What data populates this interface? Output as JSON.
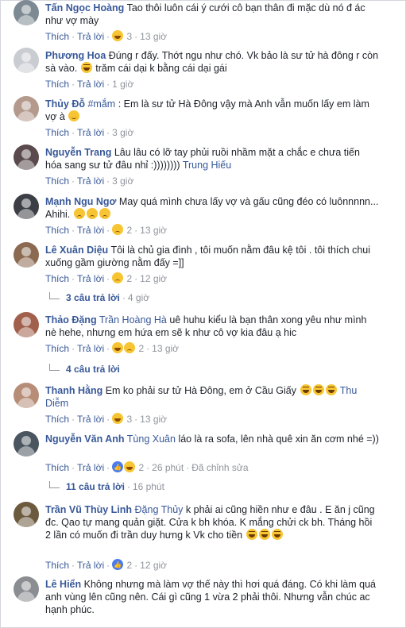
{
  "labels": {
    "like": "Thích",
    "reply": "Trả lời"
  },
  "colors": {
    "link": "#385898",
    "grey": "#90949c",
    "text": "#1d2129"
  },
  "comments": [
    {
      "author": "Tấn Ngọc Hoàng",
      "pre": "",
      "mention": "",
      "text": "Tao thôi luôn cái ý cưới cô bạn thân đi mặc dù nó đ ác như vợ mày",
      "reactions": "3",
      "time": "13 giờ",
      "avatar_color": "#7d8a93"
    },
    {
      "author": "Phương Hoa",
      "pre": "",
      "mention": "",
      "text": "Đúng r đấy. Thớt ngu như chó. Vk bảo là sư tử hà đông r còn sà vào.",
      "text2": "trăm cái dại k bằng cái dại gái",
      "reactions": "",
      "time": "1 giờ",
      "avatar_color": "#c9ccd1"
    },
    {
      "author": "Thủy Đỗ",
      "pre": "",
      "mention": "#mắm",
      "text": " : Em là sư tử Hà Đông vậy mà Anh vẫn muốn lấy em làm vợ à",
      "reactions": "",
      "time": "3 giờ",
      "avatar_color": "#b49a8d"
    },
    {
      "author": "Nguyễn Trang",
      "pre": "",
      "mention": "",
      "text": "Lâu lâu có lỡ tay phủi ruồi nhầm mặt a chắc e chưa tiến hóa sang sư tử đâu nhỉ :))))))))",
      "mention_end": "Trung Hiếu",
      "reactions": "",
      "time": "3 giờ",
      "avatar_color": "#5a4a4d"
    },
    {
      "author": "Mạnh Ngu Ngơ",
      "pre": "",
      "mention": "",
      "text": "May quá mình chưa lấy vợ và gấu cũng đéo có luônnnnn... Ahihi.",
      "reactions": "2",
      "time": "13 giờ",
      "avatar_color": "#3b3f45"
    },
    {
      "author": "Lê Xuân Diệu",
      "pre": "",
      "mention": "",
      "text": "Tôi là chủ gia đình , tôi muốn nằm đâu kệ tôi . tôi thích chui xuống gầm giường nằm đấy =]]",
      "reactions": "2",
      "time": "12 giờ",
      "avatar_color": "#8c6a52"
    },
    {
      "author": "Thảo Đặng",
      "pre": "",
      "mention": "Trần Hoàng Hà",
      "text": " uê huhu kiểu là bạn thân xong yêu như mình nè hehe, nhưng em hứa em sẽ k như cô vợ kia đâu ạ hic",
      "reactions": "2",
      "time": "13 giờ",
      "avatar_color": "#a0604c"
    },
    {
      "author": "Thanh Hằng",
      "pre": "",
      "mention": "",
      "text": "Em ko phải sư tử Hà Đông, em ở Cầu Giấy",
      "mention_end": "Thu Diễm",
      "reactions": "3",
      "time": "13 giờ",
      "avatar_color": "#b78d78"
    },
    {
      "author": "Nguyễn Văn Anh",
      "pre": "",
      "mention": "Tùng Xuân",
      "text": " láo là ra sofa, lên nhà quê xin ăn cơm nhé =))",
      "reactions": "2",
      "time": "26 phút",
      "edited": "Đã chỉnh sửa",
      "avatar_color": "#4a5560"
    },
    {
      "author": "Trần Vũ Thùy Linh",
      "pre": "",
      "mention": "Đặng Thủy",
      "text": " k phải ai cũng hiền như e đâu . E ăn j cũng đc. Qao tự mang quản giặt. Cửa k bh khóa. K mắng chửi ck bh. Tháng hồi 2 lần có muốn đi trần duy hưng k Vk cho tiền",
      "reactions": "2",
      "time": "12 giờ",
      "avatar_color": "#6c5a3e"
    },
    {
      "author": "Lê Hiển",
      "pre": "",
      "mention": "",
      "text": "Không nhưng mà làm vợ thế này thì hơi quá đáng. Có khi làm quá anh vùng lên cũng nên. Cái gì cũng 1 vừa 2 phải thôi. Nhưng vẫn chúc ac hạnh phúc.",
      "reactions": "",
      "time": "",
      "avatar_color": "#8a8d91"
    }
  ],
  "reply_threads": [
    {
      "count": "3 câu trả lời",
      "time": "4 giờ"
    },
    {
      "count": "4 câu trả lời",
      "time": ""
    },
    {
      "count": "11 câu trả lời",
      "time": "16 phút"
    }
  ]
}
